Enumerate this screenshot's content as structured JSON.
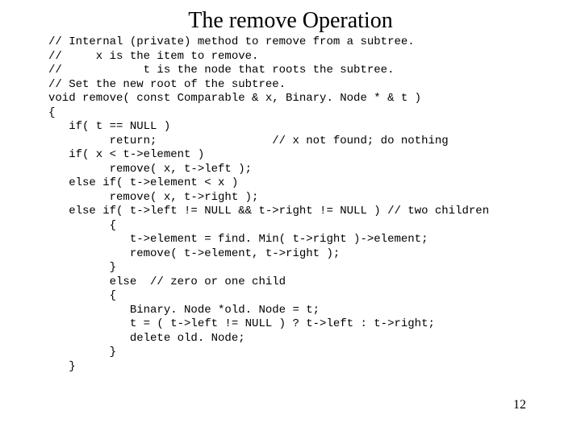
{
  "title": "The remove Operation",
  "page_number": "12",
  "code": "// Internal (private) method to remove from a subtree.\n//     x is the item to remove.\n//            t is the node that roots the subtree.\n// Set the new root of the subtree.\nvoid remove( const Comparable & x, Binary. Node * & t )\n{\n   if( t == NULL )\n         return;                 // x not found; do nothing\n   if( x < t->element )\n         remove( x, t->left );\n   else if( t->element < x )\n         remove( x, t->right );\n   else if( t->left != NULL && t->right != NULL ) // two children\n         {\n            t->element = find. Min( t->right )->element;\n            remove( t->element, t->right );\n         }\n         else  // zero or one child\n         {\n            Binary. Node *old. Node = t;\n            t = ( t->left != NULL ) ? t->left : t->right;\n            delete old. Node;\n         }\n   }"
}
